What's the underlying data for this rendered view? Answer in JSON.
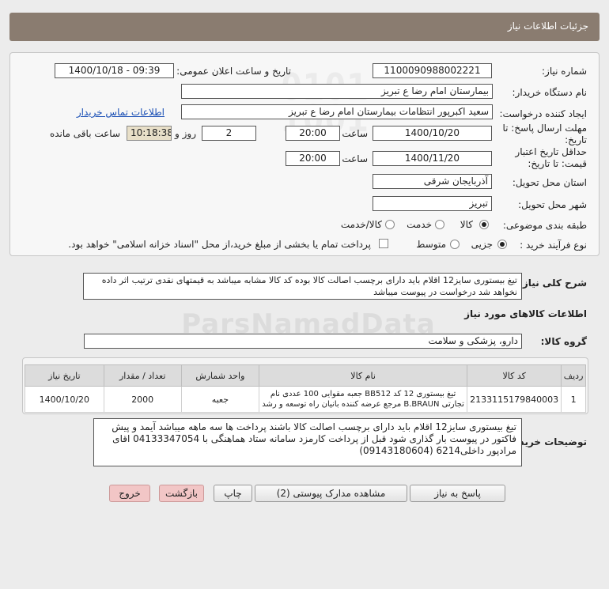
{
  "header": {
    "title": "جزئیات اطلاعات نیاز"
  },
  "form": {
    "need_number_label": "شماره نیاز:",
    "need_number": "1100090988002221",
    "announce_label": "تاریخ و ساعت اعلان عمومی:",
    "announce_value": "1400/10/18 - 09:39",
    "buyer_label": "نام دستگاه خریدار:",
    "buyer_value": "بیمارستان امام رضا  ع  تبریز",
    "creator_label": "ایجاد کننده درخواست:",
    "creator_value": "سعید اکبرپور انتظامات بیمارستان امام رضا  ع  تبریز",
    "contact_link": "اطلاعات تماس خریدار",
    "deadline_label": "مهلت ارسال پاسخ: تا تاریخ:",
    "deadline_date": "1400/10/20",
    "hour_label": "ساعت",
    "deadline_hour": "20:00",
    "days_value": "2",
    "days_label": "روز و",
    "remaining_time": "10:18:38",
    "remaining_label": "ساعت باقی مانده",
    "validity_label": "حداقل تاریخ اعتبار قیمت: تا تاریخ:",
    "validity_date": "1400/11/20",
    "validity_hour": "20:00",
    "province_label": "استان محل تحویل:",
    "province_value": "آذربایجان شرقی",
    "city_label": "شهر محل تحویل:",
    "city_value": "تبریز",
    "category_label": "طبقه بندی موضوعی:",
    "category_options": [
      "کالا",
      "خدمت",
      "کالا/خدمت"
    ],
    "category_selected": "کالا",
    "process_label": "نوع فرآیند خرید :",
    "process_options": [
      "جزیی",
      "متوسط"
    ],
    "process_selected": "جزیی",
    "payment_note": "پرداخت تمام یا بخشی از مبلغ خرید،از محل \"اسناد خزانه اسلامی\" خواهد بود."
  },
  "summary": {
    "label": "شرح کلی نیاز:",
    "text": "تیغ بیستوری سایز12 اقلام باید دارای برچسب اصالت کالا بوده کد کالا مشابه میباشد به قیمتهای نقدی ترتیب اثر داده نخواهد شد درخواست در پیوست میباشد"
  },
  "goods": {
    "section_title": "اطلاعات کالاهای مورد نیاز",
    "group_label": "گروه کالا:",
    "group_value": "دارو، پزشکی و سلامت",
    "columns": [
      "ردیف",
      "کد کالا",
      "نام کالا",
      "واحد شمارش",
      "تعداد / مقدار",
      "تاریخ نیاز"
    ],
    "rows": [
      {
        "row": "1",
        "code": "2133115179840003",
        "name": "تیغ بیستوری 12 کد BB512 جعبه مقوایی 100 عددی نام تجارتی B.BRAUN مرجع عرضه کننده بانیان راه توسعه و رشد",
        "unit": "جعبه",
        "qty": "2000",
        "date": "1400/10/20"
      }
    ]
  },
  "notes": {
    "label": "توضیحات خریدار:",
    "text": "تیغ بیستوری سایز12 اقلام باید دارای برچسب اصالت کالا باشند پرداخت ها سه ماهه میباشد آیمد و پیش فاکتور در پیوست بار گذاری شود قبل از پرداخت کارمزد سامانه ستاد هماهنگی با 04133347054 اقای مرادپور داخلی6214 (09143180604)"
  },
  "buttons": {
    "reply": "پاسخ به نیاز",
    "attachments": "مشاهده مدارک پیوستی (2)",
    "print": "چاپ",
    "back": "بازگشت",
    "exit": "خروج"
  },
  "watermark": "ParsNamadData"
}
